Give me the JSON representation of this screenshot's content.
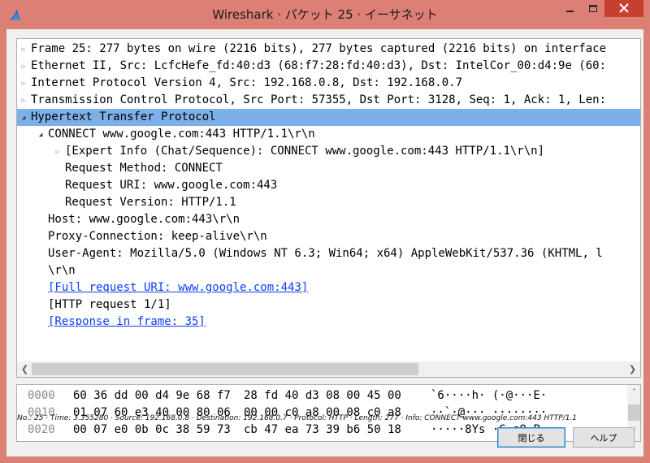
{
  "window": {
    "title": "Wireshark · パケット 25 · イーサネット",
    "accent_color": "#dc7f74",
    "close_color": "#c7402f"
  },
  "tree": {
    "rows": [
      {
        "indent": 0,
        "arrow": "closed",
        "text": "Frame 25: 277 bytes on wire (2216 bits), 277 bytes captured (2216 bits) on interface",
        "selected": false,
        "link": false
      },
      {
        "indent": 0,
        "arrow": "closed",
        "text": "Ethernet II, Src: LcfcHefe_fd:40:d3 (68:f7:28:fd:40:d3), Dst: IntelCor_00:d4:9e (60:",
        "selected": false,
        "link": false
      },
      {
        "indent": 0,
        "arrow": "closed",
        "text": "Internet Protocol Version 4, Src: 192.168.0.8, Dst: 192.168.0.7",
        "selected": false,
        "link": false
      },
      {
        "indent": 0,
        "arrow": "closed",
        "text": "Transmission Control Protocol, Src Port: 57355, Dst Port: 3128, Seq: 1, Ack: 1, Len:",
        "selected": false,
        "link": false
      },
      {
        "indent": 0,
        "arrow": "open",
        "text": "Hypertext Transfer Protocol",
        "selected": true,
        "link": false
      },
      {
        "indent": 1,
        "arrow": "open",
        "text": "CONNECT www.google.com:443 HTTP/1.1\\r\\n",
        "selected": false,
        "link": false
      },
      {
        "indent": 2,
        "arrow": "closed",
        "text": "[Expert Info (Chat/Sequence): CONNECT www.google.com:443 HTTP/1.1\\r\\n]",
        "selected": false,
        "link": false
      },
      {
        "indent": 2,
        "arrow": "none",
        "text": "Request Method: CONNECT",
        "selected": false,
        "link": false
      },
      {
        "indent": 2,
        "arrow": "none",
        "text": "Request URI: www.google.com:443",
        "selected": false,
        "link": false
      },
      {
        "indent": 2,
        "arrow": "none",
        "text": "Request Version: HTTP/1.1",
        "selected": false,
        "link": false
      },
      {
        "indent": 1,
        "arrow": "none",
        "text": "Host: www.google.com:443\\r\\n",
        "selected": false,
        "link": false
      },
      {
        "indent": 1,
        "arrow": "none",
        "text": "Proxy-Connection: keep-alive\\r\\n",
        "selected": false,
        "link": false
      },
      {
        "indent": 1,
        "arrow": "none",
        "text": "User-Agent: Mozilla/5.0 (Windows NT 6.3; Win64; x64) AppleWebKit/537.36 (KHTML, l",
        "selected": false,
        "link": false
      },
      {
        "indent": 1,
        "arrow": "none",
        "text": "\\r\\n",
        "selected": false,
        "link": false
      },
      {
        "indent": 1,
        "arrow": "none",
        "text": "[Full request URI: www.google.com:443]",
        "selected": false,
        "link": true
      },
      {
        "indent": 1,
        "arrow": "none",
        "text": "[HTTP request 1/1]",
        "selected": false,
        "link": false
      },
      {
        "indent": 1,
        "arrow": "none",
        "text": "[Response in frame: 35]",
        "selected": false,
        "link": true
      }
    ]
  },
  "hex": {
    "rows": [
      {
        "offset": "0000",
        "bytes_a": "60 36 dd 00 d4 9e 68 f7",
        "bytes_b": "28 fd 40 d3 08 00 45 00",
        "ascii": "`6····h· (·@···E·"
      },
      {
        "offset": "0010",
        "bytes_a": "01 07 60 e3 40 00 80 06",
        "bytes_b": "00 00 c0 a8 00 08 c0 a8",
        "ascii": "··`·@··· ········"
      },
      {
        "offset": "0020",
        "bytes_a": "00 07 e0 0b 0c 38 59 73",
        "bytes_b": "cb 47 ea 73 39 b6 50 18",
        "ascii": "·····8Ys ·G·s9·P·"
      }
    ]
  },
  "status": {
    "text": "No.: 25 · Time: 3.355280 · Source: 192.168.0.8 · Destination: 192.168.0.7 · Protocol: HTTP · Length: 277 · Info: CONNECT www.google.com:443 HTTP/1.1"
  },
  "buttons": {
    "close_label": "閉じる",
    "help_label": "ヘルプ"
  },
  "icons": {
    "app": "wireshark-fin-icon",
    "minimize": "minimize-icon",
    "maximize": "maximize-icon",
    "close": "close-icon"
  }
}
